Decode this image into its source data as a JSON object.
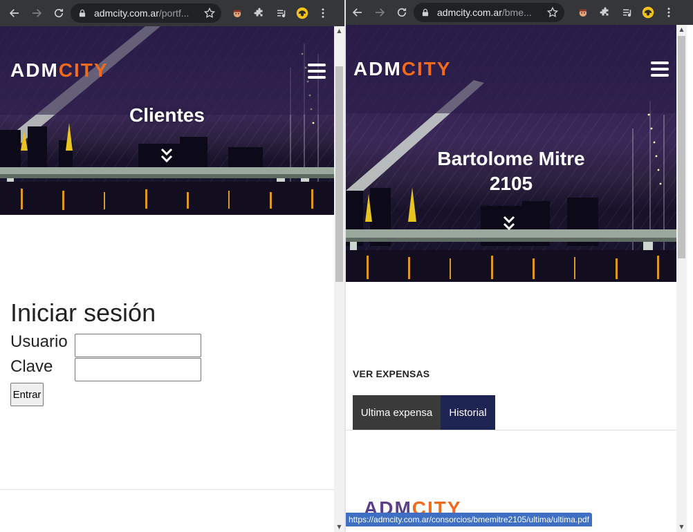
{
  "left_window": {
    "omnibox": {
      "host": "admcity.com.ar",
      "path": "/portf..."
    },
    "header": {
      "logo_adm": "ADM",
      "logo_city": "CITY"
    },
    "hero": {
      "title": "Clientes"
    },
    "login": {
      "title": "Iniciar sesión",
      "user_label": "Usuario",
      "user_value": "",
      "password_label": "Clave",
      "password_value": "",
      "submit_label": "Entrar"
    }
  },
  "right_window": {
    "omnibox": {
      "host": "admcity.com.ar",
      "path": "/bme..."
    },
    "header": {
      "logo_adm": "ADM",
      "logo_city": "CITY"
    },
    "hero": {
      "title": "Bartolome Mitre 2105"
    },
    "expensas": {
      "heading": "VER EXPENSAS",
      "tabs": [
        {
          "label": "Ultima expensa"
        },
        {
          "label": "Historial"
        }
      ]
    },
    "footer_logo": {
      "adm": "ADM",
      "city": "CITY"
    },
    "status_url": "https://admcity.com.ar/consorcios/bmemitre2105/ultima/ultima.pdf"
  },
  "colors": {
    "toolbar_bg": "#35363a",
    "brand_orange": "#f26a1b",
    "tab_dark": "#3a3a3a",
    "tab_navy": "#1f2552",
    "status_blue": "#3e6fc2"
  },
  "icons": [
    "back-arrow-icon",
    "forward-arrow-icon",
    "reload-icon",
    "lock-icon",
    "star-icon",
    "extension-avatar-icon",
    "puzzle-icon",
    "media-queue-icon",
    "profile-avatar-icon",
    "kebab-menu-icon",
    "hamburger-menu-icon",
    "double-chevron-down-icon"
  ]
}
